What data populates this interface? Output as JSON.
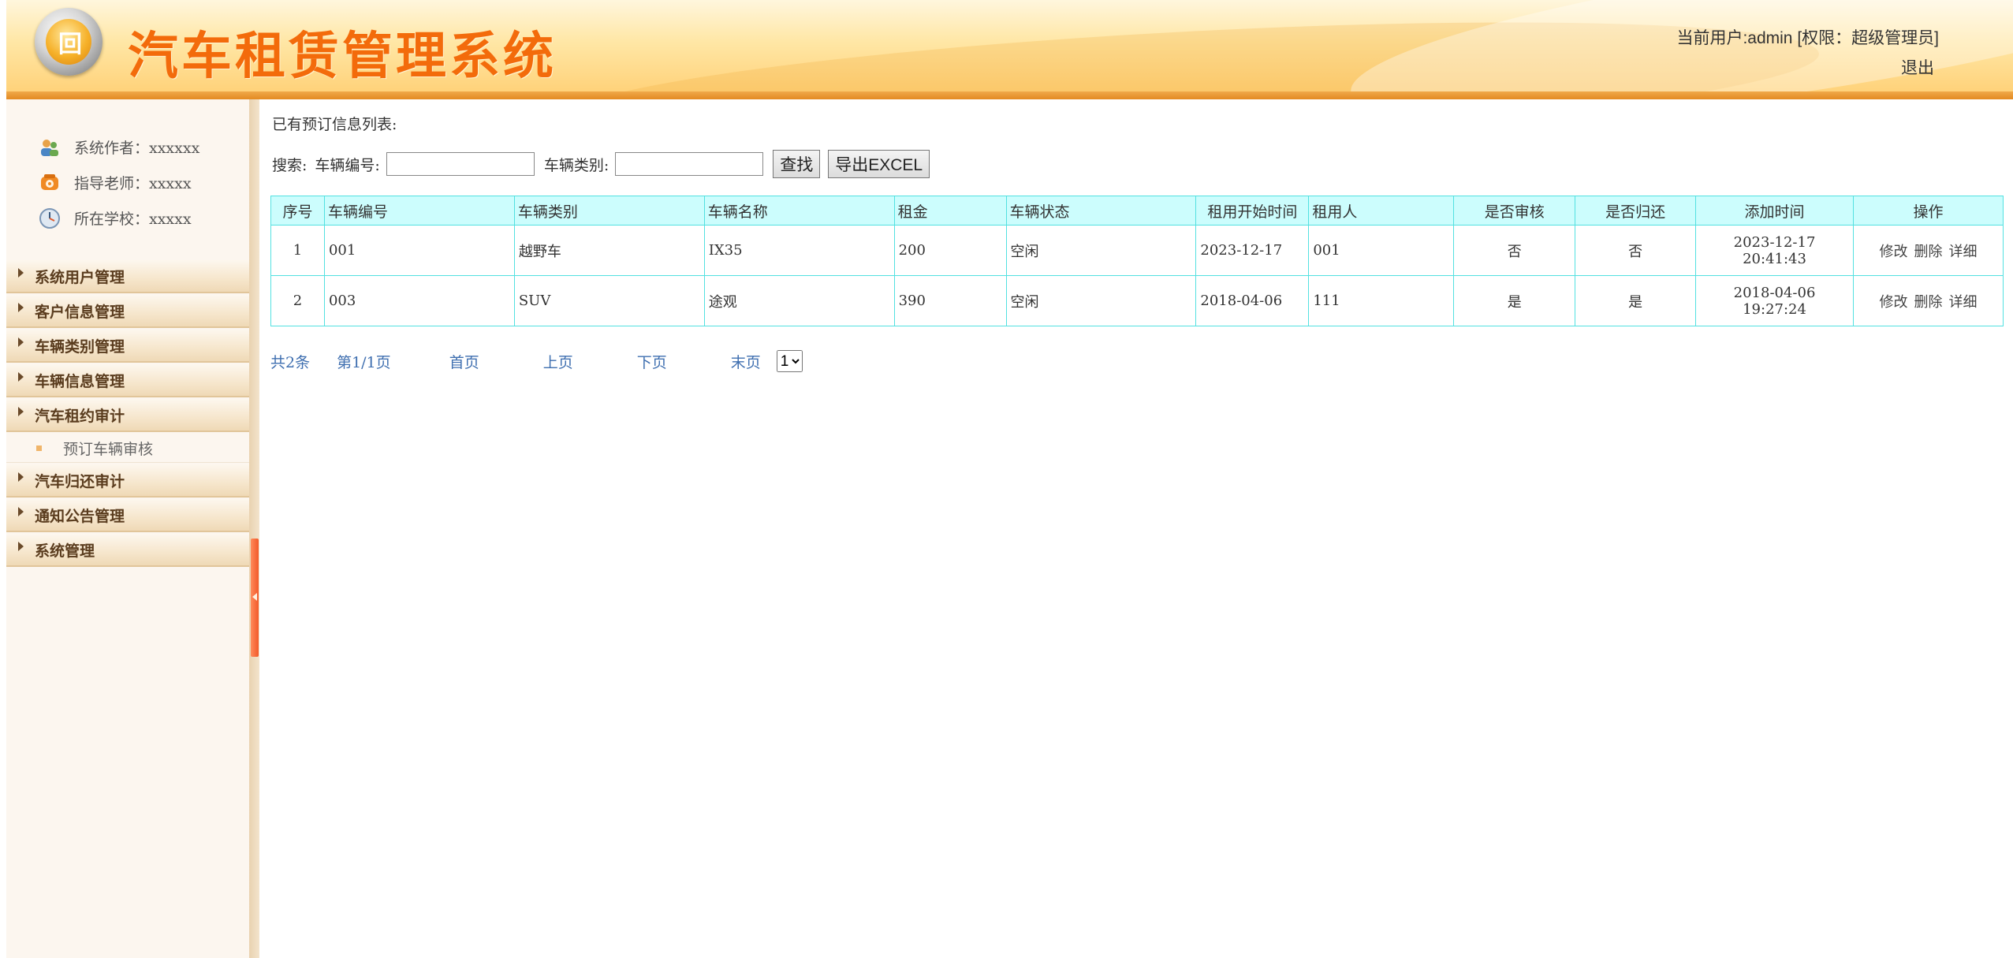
{
  "header": {
    "title": "汽车租赁管理系统",
    "logo_glyph": "回",
    "user_info": "当前用户:admin [权限：超级管理员]",
    "logout_label": "退出"
  },
  "sidebar": {
    "info": [
      {
        "icon": "users-icon",
        "label": "系统作者：xxxxxx"
      },
      {
        "icon": "phone-icon",
        "label": "指导老师：xxxxx"
      },
      {
        "icon": "clock-icon",
        "label": "所在学校：xxxxx"
      }
    ],
    "menu": [
      {
        "label": "系统用户管理"
      },
      {
        "label": "客户信息管理"
      },
      {
        "label": "车辆类别管理"
      },
      {
        "label": "车辆信息管理"
      },
      {
        "label": "汽车租约审计",
        "children": [
          "预订车辆审核"
        ]
      },
      {
        "label": "汽车归还审计"
      },
      {
        "label": "通知公告管理"
      },
      {
        "label": "系统管理"
      }
    ]
  },
  "main": {
    "list_title": "已有预订信息列表:",
    "search": {
      "prefix": "搜索:",
      "field1_label": "车辆编号:",
      "field1_value": "",
      "field2_label": "车辆类别:",
      "field2_value": "",
      "search_button": "查找",
      "export_button": "导出EXCEL"
    },
    "table": {
      "columns": [
        "序号",
        "车辆编号",
        "车辆类别",
        "车辆名称",
        "租金",
        "车辆状态",
        "租用开始时间",
        "租用人",
        "是否审核",
        "是否归还",
        "添加时间",
        "操作"
      ],
      "rows": [
        {
          "index": "1",
          "car_no": "001",
          "category": "越野车",
          "name": "IX35",
          "rent": "200",
          "status": "空闲",
          "start": "2023-12-17",
          "renter": "001",
          "audited": "否",
          "returned": "否",
          "added_date": "2023-12-17",
          "added_time": "20:41:43"
        },
        {
          "index": "2",
          "car_no": "003",
          "category": "SUV",
          "name": "途观",
          "rent": "390",
          "status": "空闲",
          "start": "2018-04-06",
          "renter": "111",
          "audited": "是",
          "returned": "是",
          "added_date": "2018-04-06",
          "added_time": "19:27:24"
        }
      ],
      "ops": {
        "edit": "修改",
        "delete": "删除",
        "detail": "详细"
      }
    },
    "pager": {
      "total": "共2条",
      "page_info": "第1/1页",
      "first": "首页",
      "prev": "上页",
      "next": "下页",
      "last": "末页",
      "select_value": "1"
    }
  }
}
